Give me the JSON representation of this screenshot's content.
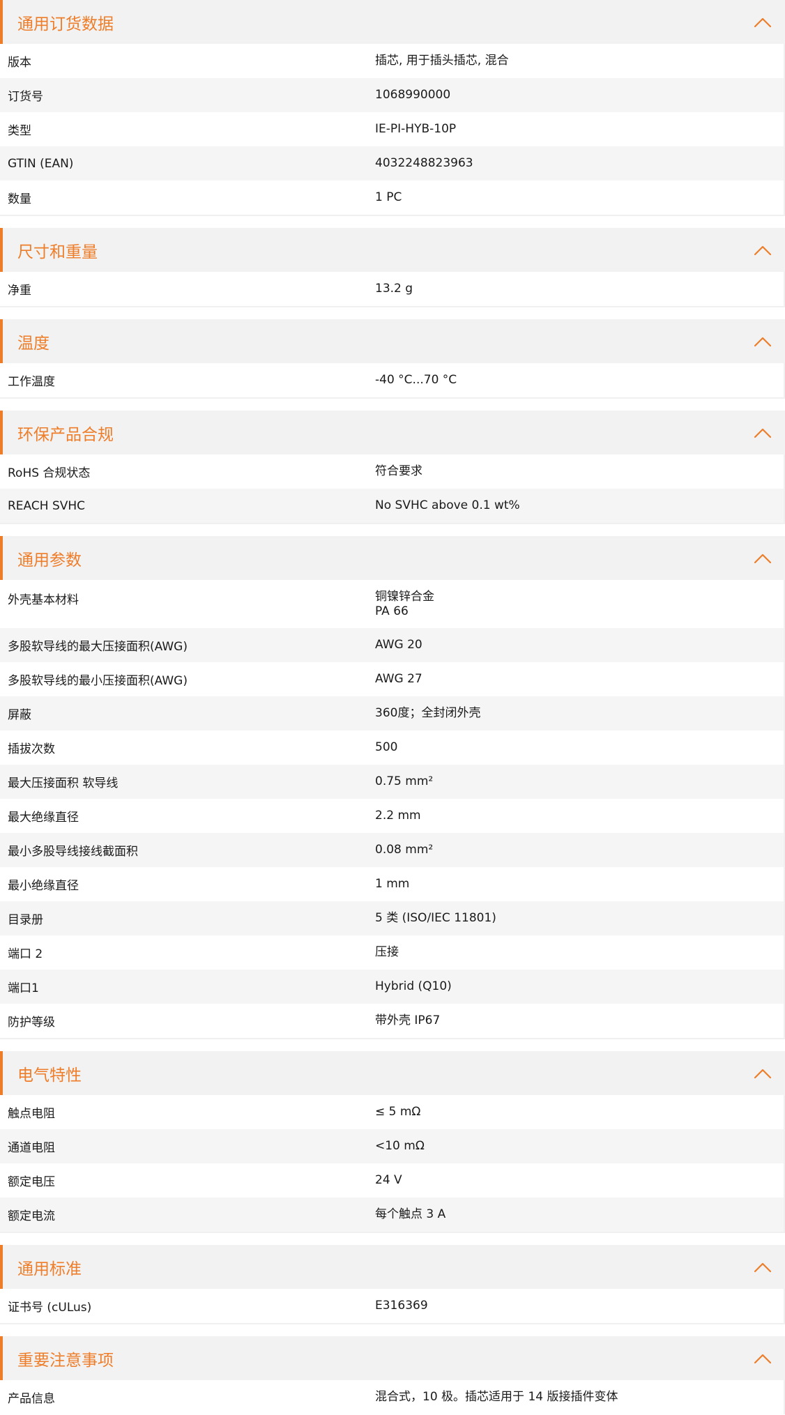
{
  "accent_color": "#ee7d2a",
  "collapse_icon": "chevron-up-icon",
  "sections": [
    {
      "title": "通用订货数据",
      "rows": [
        {
          "label": "版本",
          "value": [
            "插芯, 用于插头插芯, 混合"
          ]
        },
        {
          "label": "订货号",
          "value": [
            "1068990000"
          ]
        },
        {
          "label": "类型",
          "value": [
            "IE-PI-HYB-10P"
          ]
        },
        {
          "label": "GTIN (EAN)",
          "value": [
            "4032248823963"
          ]
        },
        {
          "label": "数量",
          "value": [
            "1  PC"
          ]
        }
      ]
    },
    {
      "title": "尺寸和重量",
      "rows": [
        {
          "label": "净重",
          "value": [
            "13.2  g"
          ]
        }
      ]
    },
    {
      "title": "温度",
      "rows": [
        {
          "label": "工作温度",
          "value": [
            "-40 °C...70 °C"
          ]
        }
      ]
    },
    {
      "title": "环保产品合规",
      "rows": [
        {
          "label": "RoHS 合规状态",
          "value": [
            "符合要求"
          ]
        },
        {
          "label": "REACH SVHC",
          "value": [
            "No SVHC above 0.1 wt%"
          ]
        }
      ]
    },
    {
      "title": "通用参数",
      "rows": [
        {
          "label": "外壳基本材料",
          "value": [
            "铜镍锌合金",
            "PA 66"
          ]
        },
        {
          "label": "多股软导线的最大压接面积(AWG)",
          "value": [
            "AWG 20"
          ]
        },
        {
          "label": "多股软导线的最小压接面积(AWG)",
          "value": [
            "AWG 27"
          ]
        },
        {
          "label": "屏蔽",
          "value": [
            "360度；全封闭外壳"
          ]
        },
        {
          "label": "插拔次数",
          "value": [
            "500"
          ]
        },
        {
          "label": "最大压接面积 软导线",
          "value": [
            "0.75  mm²"
          ]
        },
        {
          "label": "最大绝缘直径",
          "value": [
            "2.2  mm"
          ]
        },
        {
          "label": "最小多股导线接线截面积",
          "value": [
            "0.08  mm²"
          ]
        },
        {
          "label": "最小绝缘直径",
          "value": [
            "1  mm"
          ]
        },
        {
          "label": "目录册",
          "value": [
            "5 类 (ISO/IEC 11801)"
          ]
        },
        {
          "label": "端口 2",
          "value": [
            "压接"
          ]
        },
        {
          "label": "端口1",
          "value": [
            "Hybrid (Q10)"
          ]
        },
        {
          "label": "防护等级",
          "value": [
            "带外壳 IP67"
          ]
        }
      ]
    },
    {
      "title": "电气特性",
      "rows": [
        {
          "label": "触点电阻",
          "value": [
            "≤ 5 mΩ"
          ]
        },
        {
          "label": "通道电阻",
          "value": [
            "<10 mΩ"
          ]
        },
        {
          "label": "额定电压",
          "value": [
            "24  V"
          ]
        },
        {
          "label": "额定电流",
          "value": [
            "每个触点 3 A"
          ]
        }
      ]
    },
    {
      "title": "通用标准",
      "rows": [
        {
          "label": "证书号 (cULus)",
          "value": [
            "E316369"
          ]
        }
      ]
    },
    {
      "title": "重要注意事项",
      "rows": [
        {
          "label": "产品信息",
          "value": [
            "混合式，10 极。插芯适用于 14 版接插件变体"
          ]
        }
      ]
    }
  ]
}
